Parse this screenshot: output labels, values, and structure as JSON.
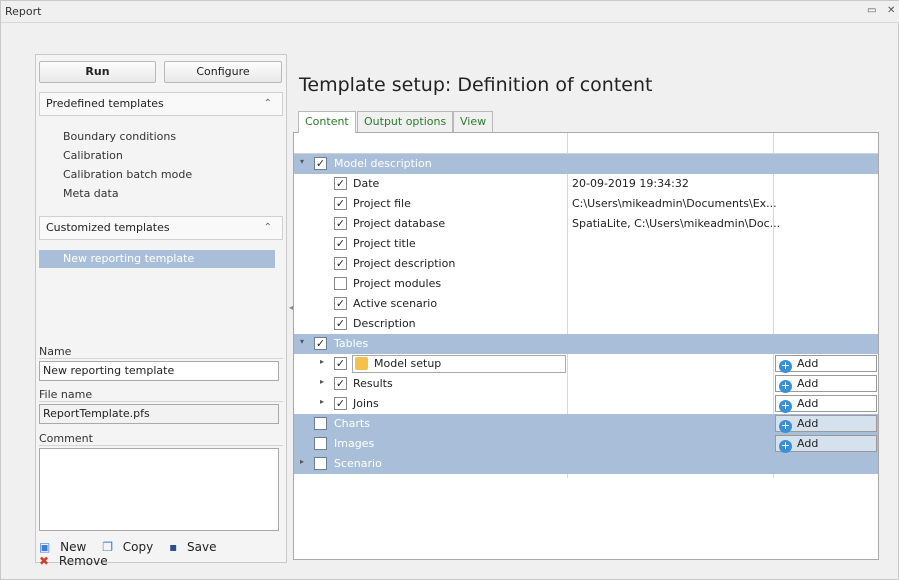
{
  "window": {
    "title": "Report"
  },
  "left": {
    "run_label": "Run",
    "configure_label": "Configure",
    "predefined_header": "Predefined templates",
    "predefined_items": [
      "Boundary conditions",
      "Calibration",
      "Calibration batch mode",
      "Meta data"
    ],
    "customized_header": "Customized templates",
    "customized_items": [
      "New reporting template"
    ],
    "name_label": "Name",
    "name_value": "New reporting template",
    "filename_label": "File name",
    "filename_value": "ReportTemplate.pfs",
    "comment_label": "Comment",
    "comment_value": "",
    "actions": {
      "new": "New",
      "copy": "Copy",
      "save": "Save",
      "remove": "Remove"
    }
  },
  "main": {
    "heading": "Template setup: Definition of content",
    "tabs": [
      "Content",
      "Output options",
      "View"
    ],
    "active_tab": "Content",
    "add_label": "Add",
    "rows": [
      {
        "label": "Model description",
        "checked": true,
        "group": true
      },
      {
        "label": "Date",
        "checked": true,
        "value": "20-09-2019 19:34:32"
      },
      {
        "label": "Project file",
        "checked": true,
        "value": "C:\\Users\\mikeadmin\\Documents\\Ex..."
      },
      {
        "label": "Project database",
        "checked": true,
        "value": "SpatiaLite, C:\\Users\\mikeadmin\\Doc..."
      },
      {
        "label": "Project title",
        "checked": true,
        "value": ""
      },
      {
        "label": "Project description",
        "checked": true,
        "value": ""
      },
      {
        "label": "Project modules",
        "checked": false,
        "value": ""
      },
      {
        "label": "Active scenario",
        "checked": true,
        "value": ""
      },
      {
        "label": "Description",
        "checked": true,
        "value": ""
      },
      {
        "label": "Tables",
        "checked": true,
        "group": true
      },
      {
        "label": "Model setup",
        "checked": true
      },
      {
        "label": "Results",
        "checked": true
      },
      {
        "label": "Joins",
        "checked": true
      },
      {
        "label": "Charts",
        "checked": false,
        "group": true
      },
      {
        "label": "Images",
        "checked": false,
        "group": true
      },
      {
        "label": "Scenario",
        "checked": false,
        "group": true
      }
    ]
  },
  "colors": {
    "group_row": "#a9bfd9",
    "tab_text": "#2d7a2d",
    "add_icon": "#3b8fd3"
  }
}
